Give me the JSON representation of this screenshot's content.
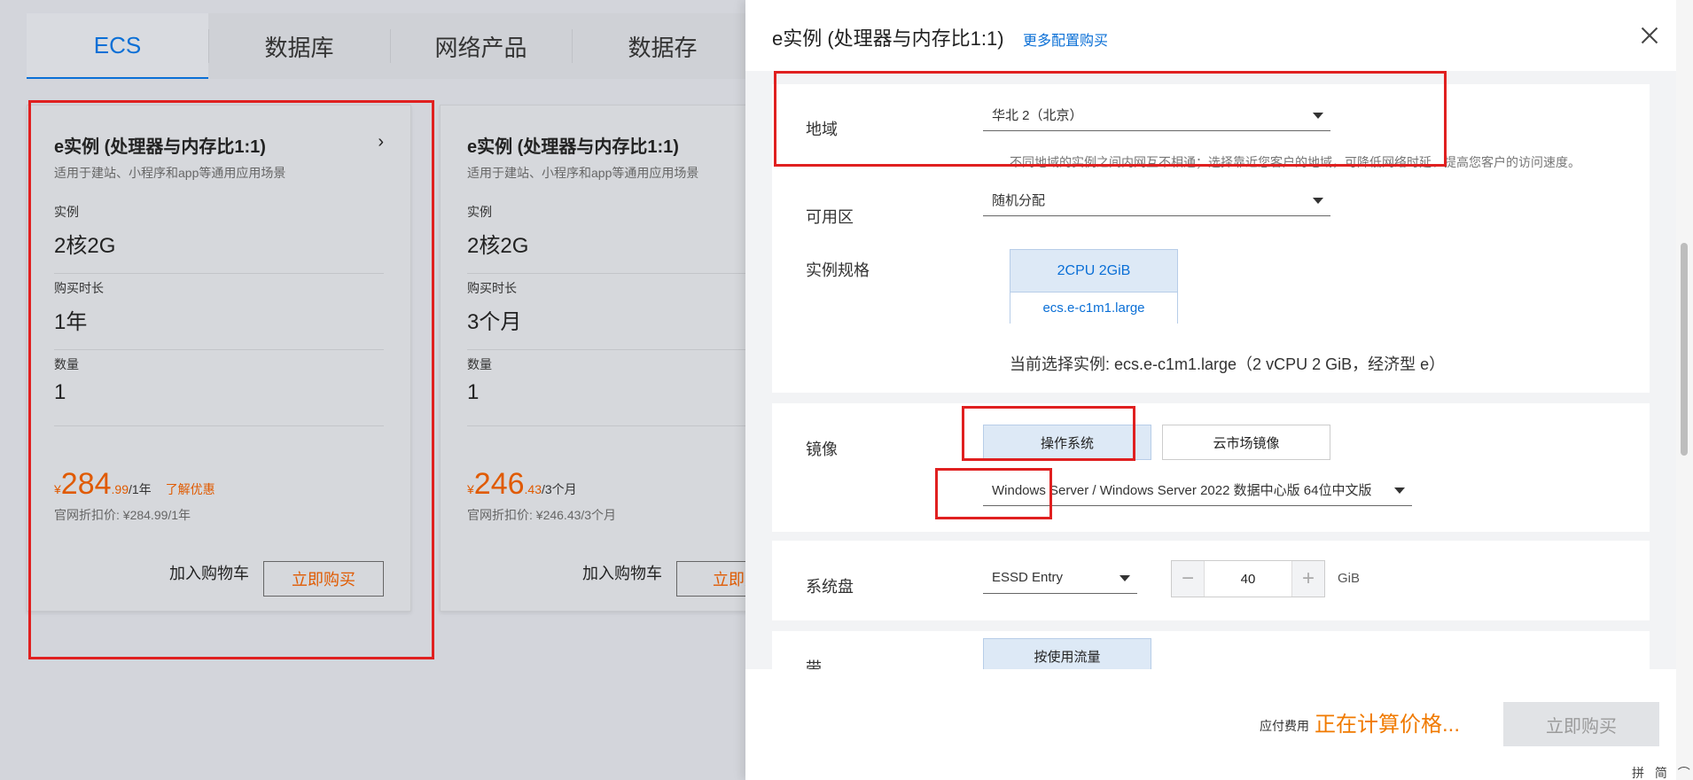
{
  "tabs": [
    "ECS",
    "数据库",
    "网络产品",
    "数据存"
  ],
  "cards": [
    {
      "title": "e实例 (处理器与内存比1:1)",
      "subtitle": "适用于建站、小程序和app等通用应用场景",
      "instance_label": "实例",
      "instance_value": "2核2G",
      "duration_label": "购买时长",
      "duration_value": "1年",
      "qty_label": "数量",
      "qty_value": "1",
      "currency": "¥",
      "price_int": "284",
      "price_dec": ".99",
      "price_per": "/1年",
      "promo": "了解优惠",
      "orig_price": "官网折扣价: ¥284.99/1年",
      "cart_label": "加入购物车",
      "buy_label": "立即购买"
    },
    {
      "title": "e实例 (处理器与内存比1:1)",
      "subtitle": "适用于建站、小程序和app等通用应用场景",
      "instance_label": "实例",
      "instance_value": "2核2G",
      "duration_label": "购买时长",
      "duration_value": "3个月",
      "qty_label": "数量",
      "qty_value": "1",
      "currency": "¥",
      "price_int": "246",
      "price_dec": ".43",
      "price_per": "/3个月",
      "orig_price": "官网折扣价: ¥246.43/3个月",
      "cart_label": "加入购物车",
      "buy_label": "立即购"
    }
  ],
  "drawer": {
    "title": "e实例 (处理器与内存比1:1)",
    "more_link": "更多配置购买",
    "region_label": "地域",
    "region_value": "华北 2（北京）",
    "region_help": "不同地域的实例之间内网互不相通；选择靠近您客户的地域，可降低网络时延、提高您客户的访问速度。",
    "zone_label": "可用区",
    "zone_value": "随机分配",
    "spec_label": "实例规格",
    "spec_top": "2CPU 2GiB",
    "spec_bottom": "ecs.e-c1m1.large",
    "current_selection": "当前选择实例: ecs.e-c1m1.large（2 vCPU 2 GiB，经济型 e）",
    "image_label": "镜像",
    "image_os": "操作系统",
    "image_market": "云市场镜像",
    "image_value": "Windows Server / Windows Server 2022 数据中心版 64位中文版",
    "disk_label": "系统盘",
    "disk_type": "ESSD Entry",
    "disk_size": "40",
    "disk_unit": "GiB",
    "minus": "−",
    "plus": "+",
    "next_label": "带",
    "next_value": "按使用流量",
    "fee_label": "应付费用",
    "fee_value": "正在计算价格...",
    "buy_now": "立即购买"
  },
  "ime": "拼 简 ⌒ ☼ ⚙",
  "colors": {
    "accent": "#0a6fd6",
    "price": "#e05a00",
    "highlight": "#e02020"
  }
}
